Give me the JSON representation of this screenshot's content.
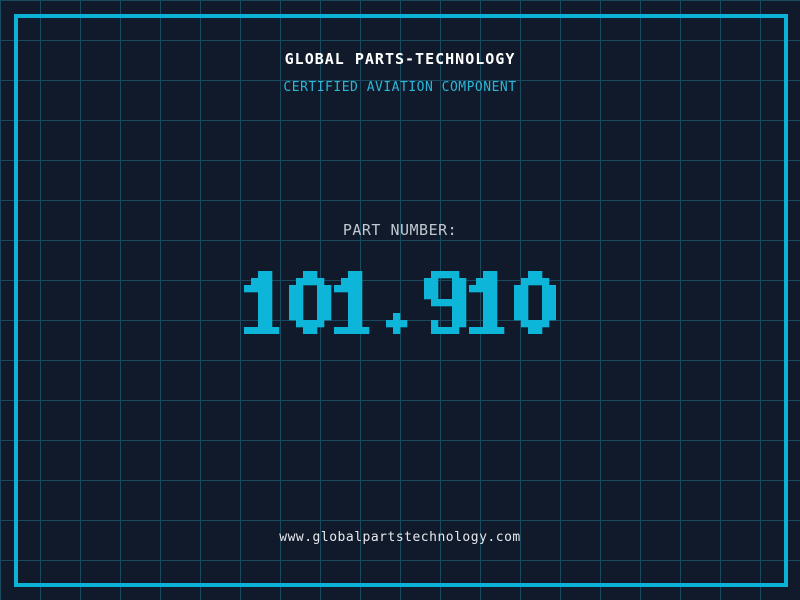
{
  "header": {
    "title": "GLOBAL PARTS-TECHNOLOGY",
    "subtitle": "CERTIFIED AVIATION COMPONENT"
  },
  "part": {
    "label": "PART NUMBER:",
    "value": "101.910"
  },
  "footer": {
    "url": "www.globalpartstechnology.com"
  },
  "colors": {
    "background": "#111a2a",
    "grid_line": "#1a4a60",
    "frame": "#0cb2d6",
    "accent_cyan": "#0db6d8",
    "title_white": "#ffffff",
    "subtitle_cyan": "#2db5d8",
    "label_gray": "#c2c8d2",
    "footer_white": "#e6e9ee"
  }
}
